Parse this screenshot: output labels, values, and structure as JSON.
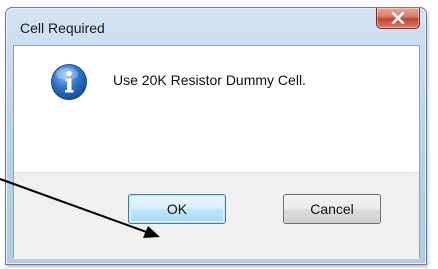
{
  "dialog": {
    "title": "Cell Required",
    "message": "Use 20K Resistor Dummy Cell.",
    "icon": "info-icon",
    "buttons": {
      "ok_label": "OK",
      "cancel_label": "Cancel"
    },
    "close_icon": "close-icon"
  },
  "annotation": {
    "type": "arrow",
    "points_to": "ok-button"
  },
  "colors": {
    "titlebar": "#bcd3ec",
    "close_button": "#c2432c",
    "info_icon": "#2a6ab8",
    "footer": "#f0f0f0"
  }
}
